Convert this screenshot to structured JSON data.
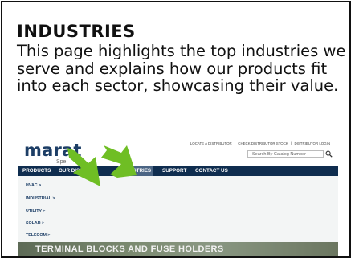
{
  "card": {
    "title": "INDUSTRIES",
    "description": "This page highlights the top industries we serve and explains how our products fit into each sector, showcasing their value."
  },
  "screenshot": {
    "logo": "marat",
    "logo_sub": "Spe",
    "util_links": [
      "LOCATE A DISTRIBUTOR",
      "CHECK DISTRIBUTOR STOCK",
      "DISTRIBUTOR LOGIN"
    ],
    "util_separator": "|",
    "search_placeholder": "Search By Catalog Number",
    "nav": [
      {
        "label": "PRODUCTS"
      },
      {
        "label": "OUR DIS"
      },
      {
        "label": "INDUSTRIES",
        "active": true
      },
      {
        "label": "SUPPORT"
      },
      {
        "label": "CONTACT US"
      }
    ],
    "dropdown": [
      "HVAC >",
      "INDUSTRIAL >",
      "UTILITY >",
      "SOLAR >",
      "TELECOM >"
    ],
    "hero_text": "TERMINAL BLOCKS AND FUSE HOLDERS",
    "colors": {
      "nav_bg": "#0f2d4f",
      "logo": "#1d3e66",
      "arrow": "#6fbe24"
    },
    "icons": {
      "search": "magnifier-icon",
      "pointer": "green-arrow-icon"
    }
  }
}
